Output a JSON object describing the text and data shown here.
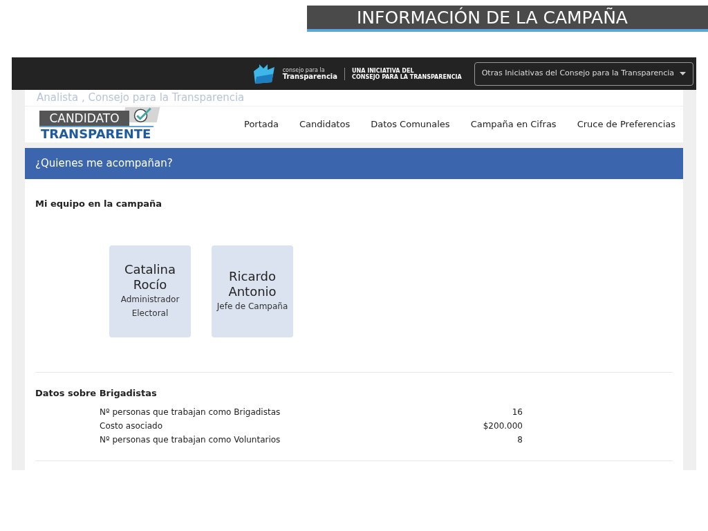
{
  "slide_title": "INFORMACIÓN DE LA CAMPAÑA",
  "topbar": {
    "org_small": "consejo para la",
    "org_name": "Transparencia",
    "tagline": "UNA INICIATIVA DEL\nCONSEJO PARA LA TRANSPARENCIA",
    "dropdown": "Otras Iniciativas del Consejo para la Transparencia"
  },
  "faded_text": "Analista , Consejo para la Transparencia",
  "logo": {
    "top": "CANDIDATO",
    "bottom": "TRANSPARENTE"
  },
  "nav": [
    {
      "label": "Portada"
    },
    {
      "label": "Candidatos"
    },
    {
      "label": "Datos Comunales"
    },
    {
      "label": "Campaña en Cifras"
    },
    {
      "label": "Cruce de Preferencias"
    }
  ],
  "panel": {
    "title": "¿Quienes me acompañan?",
    "team_heading": "Mi equipo en la campaña",
    "team": [
      {
        "name": "Catalina Rocío",
        "role": "Administrador Electoral"
      },
      {
        "name": "Ricardo Antonio",
        "role": "Jefe de Campaña"
      }
    ],
    "brigade_heading": "Datos sobre Brigadistas",
    "brigade_rows": [
      {
        "label": "Nº personas que trabajan como Brigadistas",
        "value": "16"
      },
      {
        "label": "Costo asociado",
        "value": "$200.000"
      },
      {
        "label": "Nº personas que trabajan como Voluntarios",
        "value": "8"
      }
    ]
  }
}
